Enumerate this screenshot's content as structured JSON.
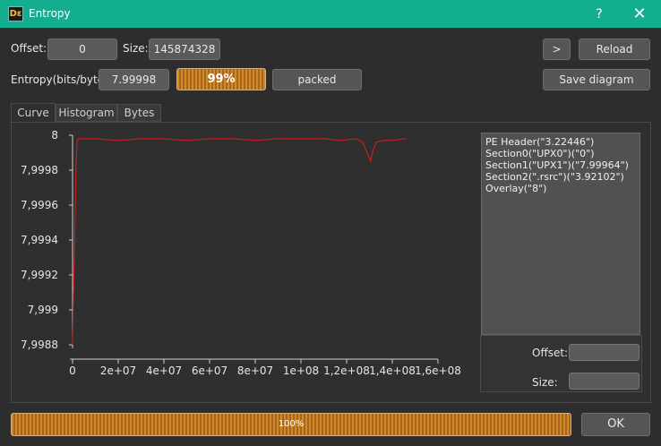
{
  "window": {
    "icon_text": "Dε",
    "title": "Entropy",
    "help_label": "?",
    "close_label": "✕"
  },
  "controls": {
    "offset_label": "Offset:",
    "offset_value": "0",
    "size_label": "Size:",
    "size_value": "145874328",
    "next_label": ">",
    "reload_label": "Reload",
    "entropy_label": "Entropy(bits/byte):",
    "entropy_value": "7.99998",
    "entropy_percent": "99%",
    "entropy_percent_fill": 0.99,
    "status_value": "packed",
    "save_diagram_label": "Save diagram"
  },
  "tabs": [
    {
      "label": "Curve",
      "active": true
    },
    {
      "label": "Histogram",
      "active": false
    },
    {
      "label": "Bytes",
      "active": false
    }
  ],
  "legend": {
    "items": [
      "PE Header(\"3.22446\")",
      "Section0(\"UPX0\")(\"0\")",
      "Section1(\"UPX1\")(\"7.99964\")",
      "Section2(\".rsrc\")(\"3.92102\")",
      "Overlay(\"8\")"
    ],
    "offset_label": "Offset:",
    "size_label": "Size:"
  },
  "footer": {
    "progress_text": "100%",
    "progress_fill": 1.0,
    "ok_label": "OK"
  },
  "chart_data": {
    "type": "line",
    "title": "",
    "xlabel": "",
    "ylabel": "",
    "xlim": [
      0,
      160000000
    ],
    "ylim": [
      7.9988,
      8
    ],
    "x_ticks": [
      0,
      20000000,
      40000000,
      60000000,
      80000000,
      100000000,
      120000000,
      140000000,
      160000000
    ],
    "x_tick_labels": [
      "0",
      "2e+07",
      "4e+07",
      "6e+07",
      "8e+07",
      "1e+08",
      "1,2e+08",
      "1,4e+08",
      "1,6e+08"
    ],
    "y_ticks": [
      7.9988,
      7.999,
      7.9992,
      7.9994,
      7.9996,
      7.9998,
      8
    ],
    "y_tick_labels": [
      "7,9988",
      "7,999",
      "7,9992",
      "7,9994",
      "7,9996",
      "7,9998",
      "8"
    ],
    "grid": false,
    "color": "#c81e1e",
    "series": [
      {
        "x": [
          0,
          400000,
          800000,
          1200000,
          1600000,
          2000000,
          2600000,
          4000000,
          10000000,
          20000000,
          30000000,
          40000000,
          50000000,
          60000000,
          70000000,
          80000000,
          90000000,
          100000000,
          110000000,
          118000000,
          124000000,
          127000000,
          129000000,
          130500000,
          131500000,
          133000000,
          136000000,
          140000000,
          145874328
        ],
        "y": [
          7.9988,
          7.9991,
          7.9993,
          7.9996,
          7.99985,
          7.99997,
          7.99998,
          7.99998,
          7.99998,
          7.99997,
          7.99998,
          7.99998,
          7.99997,
          7.99998,
          7.99998,
          7.99997,
          7.99998,
          7.99998,
          7.99998,
          7.99997,
          7.99998,
          7.99996,
          7.9999,
          7.99985,
          7.99991,
          7.99996,
          7.99997,
          7.99997,
          7.99998
        ]
      }
    ]
  }
}
